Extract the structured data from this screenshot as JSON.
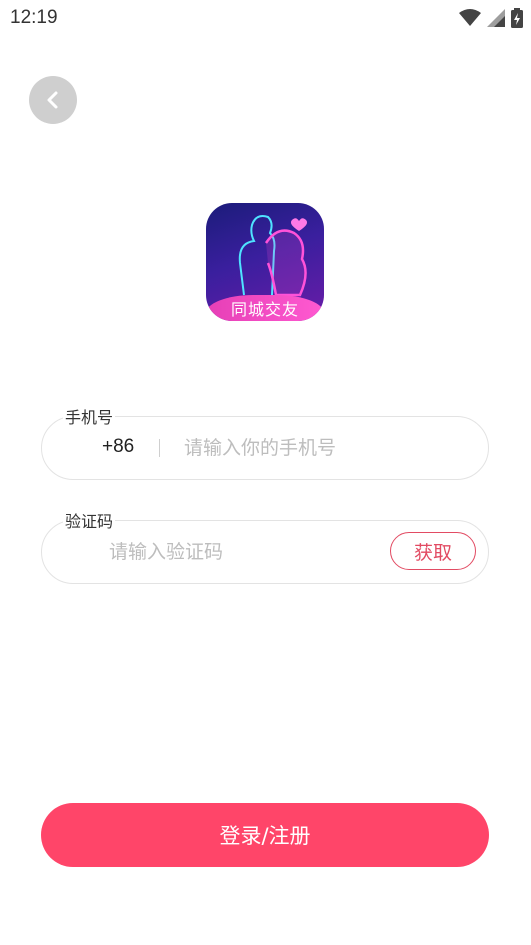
{
  "status_bar": {
    "time": "12:19",
    "icons": [
      "wifi-icon",
      "signal-icon",
      "battery-icon"
    ]
  },
  "back_button": {
    "icon": "chevron-left-icon"
  },
  "logo": {
    "text": "同城交友"
  },
  "phone": {
    "label": "手机号",
    "country_code": "+86",
    "placeholder": "请输入你的手机号"
  },
  "code": {
    "label": "验证码",
    "placeholder": "请输入验证码",
    "get_button": "获取"
  },
  "login_button": "登录/注册",
  "colors": {
    "accent": "#ff4569",
    "code_button": "#e24b63"
  }
}
